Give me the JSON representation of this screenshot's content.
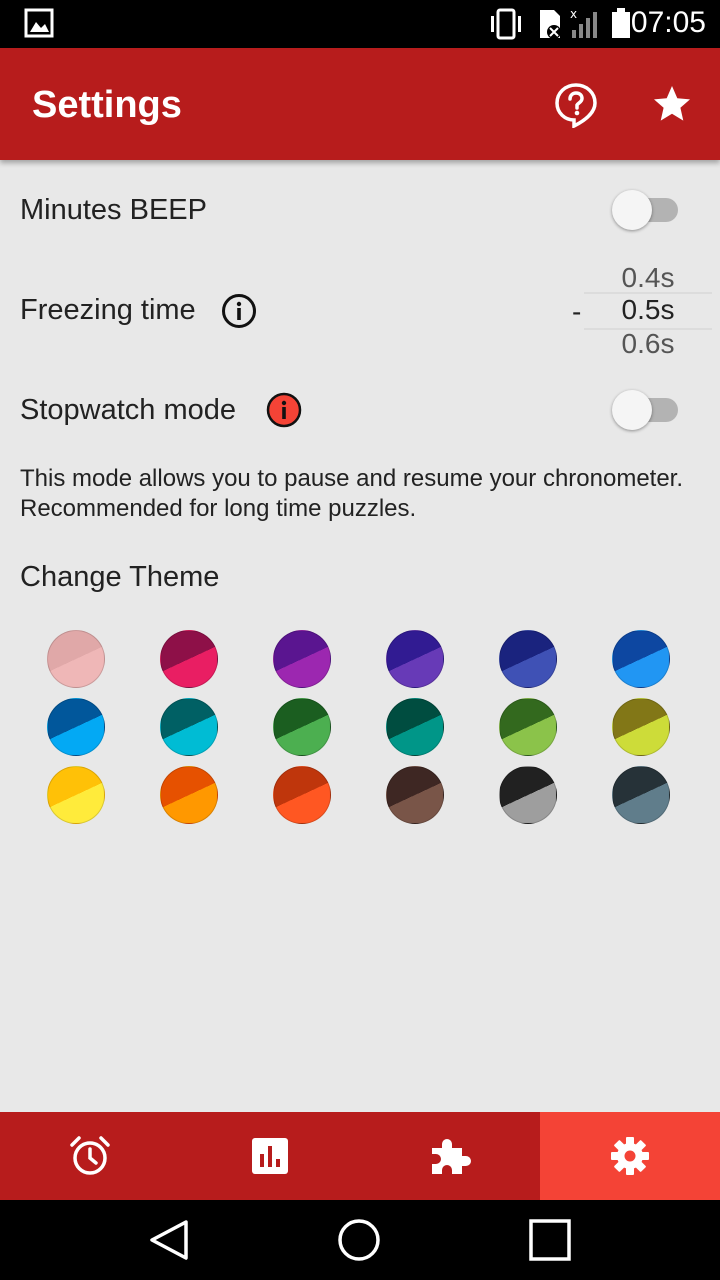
{
  "status_bar": {
    "time": "07:05",
    "icons": [
      "image-icon",
      "vibrate-icon",
      "sim-icon",
      "signal-icon",
      "battery-icon"
    ]
  },
  "app_bar": {
    "title": "Settings",
    "icons": [
      "help-icon",
      "star-icon"
    ]
  },
  "settings": {
    "minutes_beep": {
      "label": "Minutes BEEP",
      "enabled": false
    },
    "freezing_time": {
      "label": "Freezing time",
      "dash": "-",
      "prev": "0.4s",
      "current": "0.5s",
      "next": "0.6s"
    },
    "stopwatch_mode": {
      "label": "Stopwatch mode",
      "enabled": false,
      "description": "This mode allows you to pause and resume your chronometer. Recommended for long time puzzles."
    },
    "change_theme": {
      "label": "Change Theme",
      "themes": [
        {
          "dark": "#e0a8a8",
          "light": "#efb7b7"
        },
        {
          "dark": "#8e1048",
          "light": "#e91e63"
        },
        {
          "dark": "#5a1590",
          "light": "#9c27b0"
        },
        {
          "dark": "#311b92",
          "light": "#673ab7"
        },
        {
          "dark": "#1a237e",
          "light": "#3f51b5"
        },
        {
          "dark": "#0d47a1",
          "light": "#2196f3"
        },
        {
          "dark": "#01579b",
          "light": "#03a9f4"
        },
        {
          "dark": "#006064",
          "light": "#00bcd4"
        },
        {
          "dark": "#1b5e20",
          "light": "#4caf50"
        },
        {
          "dark": "#004d40",
          "light": "#009688"
        },
        {
          "dark": "#33691e",
          "light": "#8bc34a"
        },
        {
          "dark": "#827717",
          "light": "#cddc39"
        },
        {
          "dark": "#ffc107",
          "light": "#ffeb3b"
        },
        {
          "dark": "#e65100",
          "light": "#ff9800"
        },
        {
          "dark": "#bf360c",
          "light": "#ff5722"
        },
        {
          "dark": "#3e2723",
          "light": "#795548"
        },
        {
          "dark": "#212121",
          "light": "#9e9e9e"
        },
        {
          "dark": "#263238",
          "light": "#607d8b"
        }
      ]
    }
  },
  "bottom_nav": {
    "items": [
      "alarm-clock-icon",
      "stats-icon",
      "puzzle-icon",
      "gear-icon"
    ],
    "active_index": 3
  },
  "colors": {
    "primary": "#b71c1c",
    "accent": "#f44336",
    "background": "#e8e8e8"
  }
}
